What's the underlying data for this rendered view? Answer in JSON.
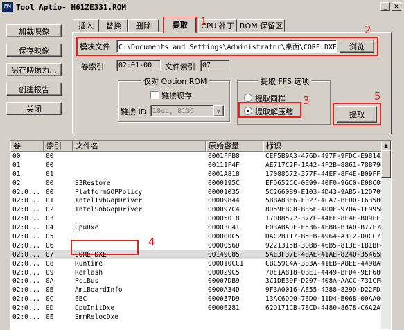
{
  "window": {
    "title": "Tool Aptio- H61ZE331.ROM",
    "icon_text": "MM"
  },
  "left_buttons": [
    "加载映像",
    "保存映像",
    "另存映像为...",
    "创建报告",
    "关闭"
  ],
  "tabs": [
    "插入",
    "替换",
    "删除",
    "提取",
    "CPU 补丁",
    "ROM 保留区"
  ],
  "extract": {
    "module_file_label": "模块文件",
    "module_file_value": "C:\\Documents and Settings\\Administrator\\桌面\\CORE_DXE",
    "browse_label": "浏览",
    "volume_index_label": "卷索引",
    "volume_index_value": "02:01-00",
    "file_index_label": "文件索引",
    "file_index_value": "07",
    "option_rom_group": "仅对 Option ROM",
    "link_existing_label": "链接现存",
    "link_id_label": "链接 ID",
    "link_id_value": "10ec, 8136",
    "ffs_group": "提取 FFS 选项",
    "extract_as_is_label": "提取同样",
    "extract_decompress_label": "提取解压缩",
    "extract_button": "提取"
  },
  "annotations": [
    "1",
    "2",
    "3",
    "4",
    "5"
  ],
  "table": {
    "columns": [
      "卷",
      "索引",
      "文件名",
      "原始容量",
      "标识"
    ],
    "rows": [
      [
        "00",
        "00",
        "",
        "0001FFB8",
        "CEF5B9A3-476D-497F-9FDC-E98143"
      ],
      [
        "01",
        "00",
        "",
        "00111F4F",
        "AE717C2F-1A42-4F2B-8861-78B79C"
      ],
      [
        "01",
        "01",
        "",
        "0001A818",
        "17088572-377F-44EF-8F4E-B09FFF"
      ],
      [
        "02",
        "00",
        "S3Restore",
        "0000195C",
        "EFD652CC-0E99-40F0-96C0-E08C08"
      ],
      [
        "02:0...",
        "00",
        "PlatformGOPPolicy",
        "00001035",
        "5C266089-E103-4D43-9AB5-12D709"
      ],
      [
        "02:0...",
        "01",
        "IntelIvbGopDriver",
        "00009844",
        "5BBA83E6-F027-4CA7-BFD0-16358C"
      ],
      [
        "02:0...",
        "02",
        "IntelSnbGopDriver",
        "000097C4",
        "8D59EBC8-B85E-400E-970A-1F995D"
      ],
      [
        "02:0...",
        "03",
        "",
        "00005018",
        "17088572-377F-44EF-8F4E-B09FFF"
      ],
      [
        "02:0...",
        "04",
        "CpuDxe",
        "00003C41",
        "E03ABADF-E536-4E88-B3A0-B77F78"
      ],
      [
        "02:0...",
        "05",
        "",
        "000000C5",
        "DAC2B117-B5FB-4964-A312-0DCC77"
      ],
      [
        "02:0...",
        "06",
        "",
        "0000056D",
        "9221315B-30BB-46B5-813E-1B1BF4"
      ],
      [
        "02:0...",
        "07",
        "CORE DXE",
        "00149C85",
        "5AE3F37E-4EAE-41AE-8240-35465B"
      ],
      [
        "02:0...",
        "08",
        "Runtime",
        "000010CC1",
        "CBC59C4A-383A-41EB-A8EE-4498AE"
      ],
      [
        "02:0...",
        "09",
        "ReFlash",
        "000029C5",
        "70E1A818-0BE1-4449-BFD4-9EF68C"
      ],
      [
        "02:0...",
        "0A",
        "PciBus",
        "00007DB9",
        "3C1DE39F-D207-408A-AACC-731CFB"
      ],
      [
        "02:0...",
        "0B",
        "AmiBoardInfo",
        "0000A34D",
        "9F3A0016-AE55-4288-829D-D22FD3"
      ],
      [
        "02:0...",
        "0C",
        "EBC",
        "000037D9",
        "13AC6DD0-73D0-11D4-B06B-00AA00"
      ],
      [
        "02:0...",
        "0D",
        "CpuInitDxe",
        "0000E281",
        "62D171CB-78CD-4480-8678-C6A2A7"
      ],
      [
        "02:0...",
        "0E",
        "SmmRelocDxe",
        "",
        ""
      ]
    ]
  }
}
